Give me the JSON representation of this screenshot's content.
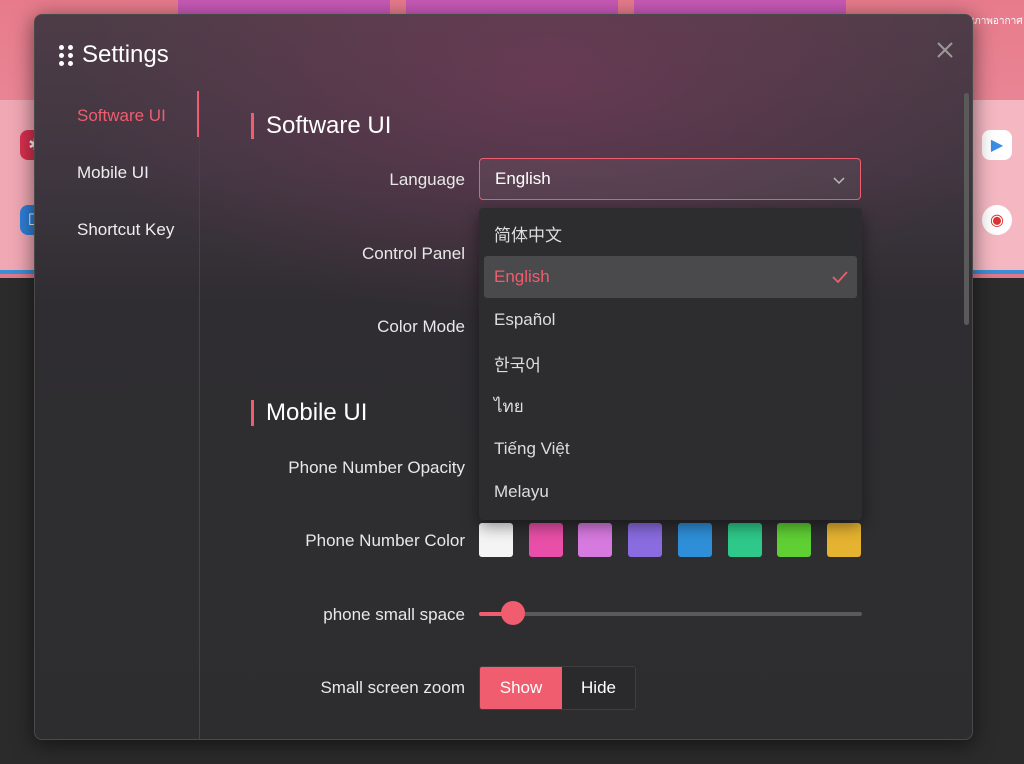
{
  "background": {
    "weather_text": "สภาพอากาศ"
  },
  "dialog": {
    "title": "Settings",
    "close_icon": "close-icon"
  },
  "nav": {
    "items": [
      {
        "label": "Software UI",
        "active": true
      },
      {
        "label": "Mobile UI",
        "active": false
      },
      {
        "label": "Shortcut Key",
        "active": false
      }
    ]
  },
  "software_ui": {
    "section_title": "Software UI",
    "language_label": "Language",
    "language_value": "English",
    "control_panel_label": "Control Panel",
    "color_mode_label": "Color Mode"
  },
  "language_dropdown": {
    "options": [
      "简体中文",
      "English",
      "Español",
      "한국어",
      "ไทย",
      "Tiếng Việt",
      "Melayu"
    ],
    "selected": "English"
  },
  "mobile_ui": {
    "section_title": "Mobile UI",
    "phone_number_opacity_label": "Phone Number Opacity",
    "phone_number_color_label": "Phone Number Color",
    "phone_number_colors": [
      "#f4f4f4",
      "#e94fa8",
      "#d77ae0",
      "#8a6ce0",
      "#2e8fd8",
      "#2ec98a",
      "#5fcf34",
      "#e6b330"
    ],
    "phone_small_space_label": "phone small space",
    "phone_small_space_value": 0.09,
    "small_screen_zoom_label": "Small screen zoom",
    "zoom_show": "Show",
    "zoom_hide": "Hide",
    "zoom_selected": "Show"
  },
  "colors": {
    "accent": "#ef5d6e",
    "dialog_bg": "#2d2d2f"
  }
}
